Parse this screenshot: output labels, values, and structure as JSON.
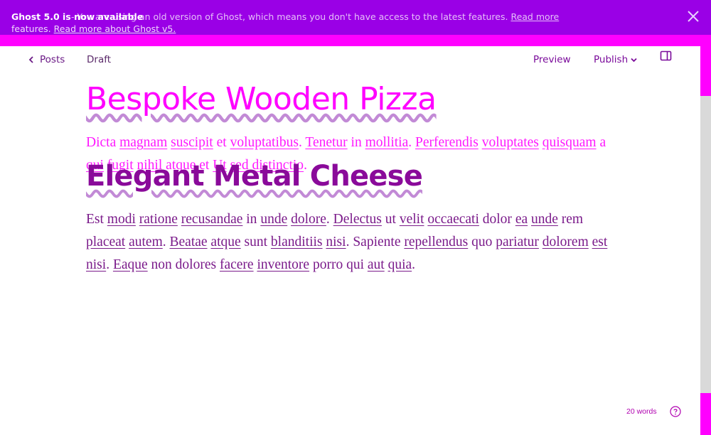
{
  "banner": {
    "line1_bold": "Ghost 5.0 is now available",
    "line1_rest": "- You are using an old version of Ghost, which means you don't have access to the latest features.",
    "line1_link": "Read more",
    "line2_text": "features.",
    "line2_link": "Read more about Ghost v5."
  },
  "header": {
    "back_label": "Posts",
    "status": "Draft",
    "preview_label": "Preview",
    "publish_label": "Publish"
  },
  "post": {
    "title": "Bespoke Wooden Pizza",
    "heading": "Elegant Metal Cheese",
    "paragraph1": [
      {
        "t": "Dicta ",
        "u": false
      },
      {
        "t": "magnam",
        "u": true
      },
      {
        "t": " ",
        "u": false
      },
      {
        "t": "suscipit",
        "u": true
      },
      {
        "t": " et ",
        "u": false
      },
      {
        "t": "voluptatibus",
        "u": true
      },
      {
        "t": ". ",
        "u": false
      },
      {
        "t": "Tenetur",
        "u": true
      },
      {
        "t": " in ",
        "u": false
      },
      {
        "t": "mollitia",
        "u": true
      },
      {
        "t": ". ",
        "u": false
      },
      {
        "t": "Perferendis",
        "u": true
      },
      {
        "t": " ",
        "u": false
      },
      {
        "t": "voluptates",
        "u": true
      },
      {
        "t": " ",
        "u": false
      },
      {
        "t": "quisquam",
        "u": true
      },
      {
        "t": " a ",
        "u": false
      },
      {
        "t": "qui",
        "u": true
      },
      {
        "t": " ",
        "u": false
      },
      {
        "t": "fugit",
        "u": true
      },
      {
        "t": " ",
        "u": false
      },
      {
        "t": "nihil",
        "u": true
      },
      {
        "t": " atque et ",
        "u": false
      },
      {
        "t": "Ut",
        "u": true
      },
      {
        "t": " ",
        "u": false
      },
      {
        "t": "sed",
        "u": true
      },
      {
        "t": " ",
        "u": false
      },
      {
        "t": "distinctio",
        "u": true
      },
      {
        "t": ".",
        "u": false
      }
    ],
    "paragraph2": [
      {
        "t": "Est ",
        "u": false
      },
      {
        "t": "modi",
        "u": true
      },
      {
        "t": " ",
        "u": false
      },
      {
        "t": "ratione",
        "u": true
      },
      {
        "t": " ",
        "u": false
      },
      {
        "t": "recusandae",
        "u": true
      },
      {
        "t": " in ",
        "u": false
      },
      {
        "t": "unde",
        "u": true
      },
      {
        "t": " ",
        "u": false
      },
      {
        "t": "dolore",
        "u": true
      },
      {
        "t": ". ",
        "u": false
      },
      {
        "t": "Delectus",
        "u": true
      },
      {
        "t": " ut ",
        "u": false
      },
      {
        "t": "velit",
        "u": true
      },
      {
        "t": " ",
        "u": false
      },
      {
        "t": "occaecati",
        "u": true
      },
      {
        "t": " dolor ",
        "u": false
      },
      {
        "t": "ea",
        "u": true
      },
      {
        "t": " ",
        "u": false
      },
      {
        "t": "unde",
        "u": true
      },
      {
        "t": " rem ",
        "u": false
      },
      {
        "t": "placeat",
        "u": true
      },
      {
        "t": " ",
        "u": false
      },
      {
        "t": "autem",
        "u": true
      },
      {
        "t": ". ",
        "u": false
      },
      {
        "t": "Beatae",
        "u": true
      },
      {
        "t": " ",
        "u": false
      },
      {
        "t": "atque",
        "u": true
      },
      {
        "t": " sunt ",
        "u": false
      },
      {
        "t": "blanditiis",
        "u": true
      },
      {
        "t": " ",
        "u": false
      },
      {
        "t": "nisi",
        "u": true
      },
      {
        "t": ". Sapiente ",
        "u": false
      },
      {
        "t": "repellendus",
        "u": true
      },
      {
        "t": " quo ",
        "u": false
      },
      {
        "t": "pariatur",
        "u": true
      },
      {
        "t": " ",
        "u": false
      },
      {
        "t": "dolorem",
        "u": true
      },
      {
        "t": " ",
        "u": false
      },
      {
        "t": "est",
        "u": true
      },
      {
        "t": " ",
        "u": false
      },
      {
        "t": "nisi",
        "u": true
      },
      {
        "t": ". ",
        "u": false
      },
      {
        "t": "Eaque",
        "u": true
      },
      {
        "t": " non dolores ",
        "u": false
      },
      {
        "t": "facere",
        "u": true
      },
      {
        "t": " ",
        "u": false
      },
      {
        "t": "inventore",
        "u": true
      },
      {
        "t": " porro qui ",
        "u": false
      },
      {
        "t": "aut",
        "u": true
      },
      {
        "t": " ",
        "u": false
      },
      {
        "t": "quia",
        "u": true
      },
      {
        "t": ".",
        "u": false
      }
    ]
  },
  "footer": {
    "word_count": "20 words"
  },
  "icons": {
    "back": "chevron-left-icon",
    "publish_caret": "chevron-down-icon",
    "sidebar": "sidebar-toggle-icon",
    "help": "help-circle-icon",
    "close": "close-icon"
  },
  "colors": {
    "banner_bg": "#9a00e6",
    "accent": "#ff00ff",
    "text_primary": "#7a1a8a"
  }
}
